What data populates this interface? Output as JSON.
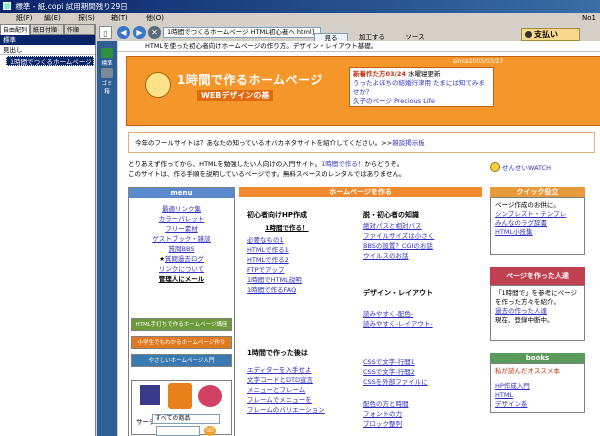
{
  "window": {
    "title": "標準 - 紙.copi 試用期間残り29日",
    "page_number": "No1"
  },
  "menubar": [
    "紙(F)",
    "編(E)",
    "探(S)",
    "箱(T)",
    "他(O)"
  ],
  "left_panel": {
    "tabs": [
      "自由配列",
      "紙日付順",
      "作順"
    ],
    "root": "標準",
    "section": "見出し",
    "selected_item": "1時間でつくるホームページ"
  },
  "icon_column": [
    {
      "label": "標準",
      "icon": "folder-icon"
    },
    {
      "label": "ゴミ箱",
      "icon": "trash-icon"
    }
  ],
  "toolbar": {
    "address": "1時間でつくるホームページ HTML初心者へ html]",
    "subtabs": [
      "見る",
      "加工する",
      "ソース"
    ],
    "pay_label": "支払い"
  },
  "description": "HTMLを使った初心者向けホームページの作り方。デザイン・レイアウト基礎。",
  "page": {
    "since": "since2003/03/27",
    "logo_title": "1時間で作るホームページ",
    "logo_subtitle": "WEBデザインの基",
    "news": {
      "heading": "新着作た方03/24",
      "date_note": "水曜寝更新",
      "link1": "うったよほちの結婚行津用",
      "link2": "たまには知てみませか？",
      "link3": "久子のページ",
      "link4": "Precious Life"
    },
    "guestbook_text": "今年のフールサイトは？あなたの知っているオバカネタサイトを紹介してください。>>",
    "guestbook_link": "雑談掲示板",
    "intro_line1": "とりあえず作ってから、HTMLを勉強したい人向けの入門サイト。",
    "intro_link": "1時間で作る！",
    "intro_line1_end": "からどうぞ。",
    "intro_line2": "このサイトは、作る手順を説明しているページです。無料スペースのレンタルではありません。",
    "watch_label": "せんせいWATCH",
    "menu": {
      "header": "menu",
      "items": [
        "最適リンク集",
        "カラーパレット",
        "フリー素材",
        "ゲストブック・雑談",
        "質問BBS",
        "質問過去ログ",
        "リンクについて",
        "管理人にメール"
      ],
      "banner1": "HTML手打ちで作るホームページ講座",
      "banner2": "小学生でもわかるホームページ作り",
      "banner3": "やさしいホームページ入門",
      "search_label": "サーチ:",
      "search_select": "すべての商品",
      "go_label": "GO"
    },
    "center": {
      "header": "ホームページを作る",
      "col1_heading": "初心者向けHP作成",
      "col1_items": [
        "1時間で作る！",
        "必要なもの1",
        "HTMLで作る1",
        "HTMLで作る2",
        "FTPでアップ",
        "1時間でHTML説明",
        "1時間で作るFAQ"
      ],
      "col2_heading": "脱・初心者の知識",
      "col2_items": [
        "絶対パスと相対パス",
        "ファイルサイズは小さく",
        "BBSの設置？CGIのお話",
        "ウイルスのお話"
      ],
      "col3_heading": "デザイン・レイアウト",
      "col3_items": [
        "読みやすく-配色-",
        "読みやすく-レイアウト-"
      ],
      "col4_heading": "1時間で作った後は",
      "col4_items": [
        "エディターを入手せよ",
        "文字コードとDTD宣言",
        "メニューとフレーム",
        "フレームでメニューを",
        "フレームのバリエーション"
      ],
      "col5_items": [
        "CSSで文字-行間1",
        "CSSで文字-行間2",
        "CSSを外部ファイルに",
        "配色の方と時間",
        "フォントの力",
        "ブロック整列"
      ]
    },
    "right": {
      "quick_header": "クイック役立",
      "quick_text": "ページ作成のお供に。",
      "quick_links": [
        "シンプレスト・テンプレ",
        "みんなのラグ辞書",
        "HTML小技集"
      ],
      "about_header": "ページを作った人達",
      "about_text1": "「1時間で」を参考にページを作った方々を紹介。",
      "about_link": "過去の作った人達",
      "about_text2": "現在、登録中断中。",
      "books_header": "books",
      "books_text": "私が読んだオススメ本",
      "book_links": [
        "HP作成入門",
        "HTML",
        "デザイン系"
      ]
    }
  }
}
